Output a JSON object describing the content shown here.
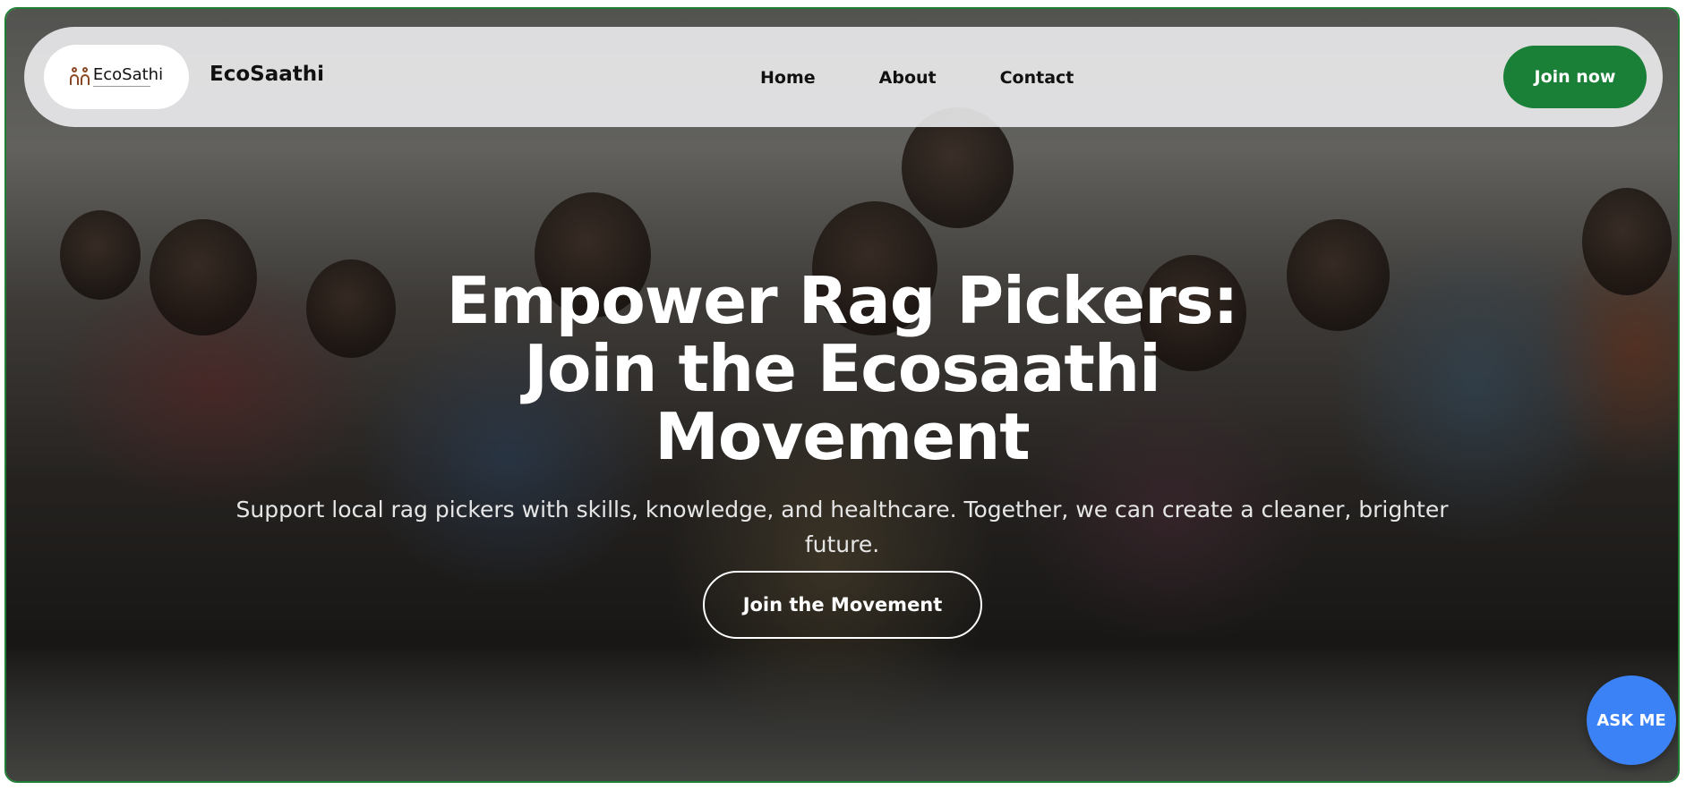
{
  "navbar": {
    "logo_text": "EcoSathi",
    "brand_name": "EcoSaathi",
    "links": [
      {
        "label": "Home"
      },
      {
        "label": "About"
      },
      {
        "label": "Contact"
      }
    ],
    "cta_label": "Join now"
  },
  "hero": {
    "title_line1": "Empower Rag Pickers:",
    "title_line2": "Join the Ecosaathi",
    "title_line3": "Movement",
    "subtitle": "Support local rag pickers with skills, knowledge, and healthcare. Together, we can create a cleaner, brighter future.",
    "cta_label": "Join the Movement"
  },
  "chat": {
    "label": "ASK ME"
  },
  "colors": {
    "primary_green": "#1a7f37",
    "ask_blue": "#3b82f6",
    "frame_border": "#1e7e34"
  }
}
